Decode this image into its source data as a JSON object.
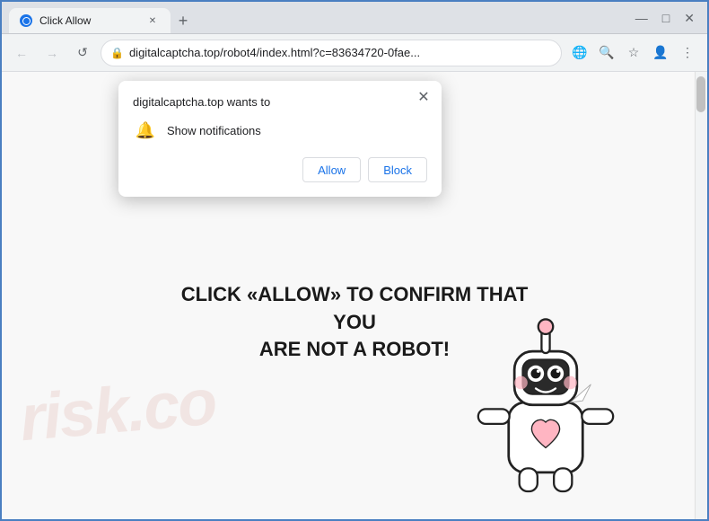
{
  "browser": {
    "title": "Click Allow",
    "tab_title": "Click Allow",
    "new_tab_label": "+",
    "url": "digitalcaptcha.top/robot4/index.html?c=83634720-0fae...",
    "window_controls": {
      "minimize": "—",
      "maximize": "□",
      "close": "✕"
    }
  },
  "nav": {
    "back_arrow": "←",
    "forward_arrow": "→",
    "refresh": "↺",
    "translate_icon": "🌐",
    "search_icon": "🔍",
    "bookmark_icon": "☆",
    "profile_icon": "👤",
    "menu_icon": "⋮",
    "dropdown_icon": "▾"
  },
  "popup": {
    "title": "digitalcaptcha.top wants to",
    "notification_label": "Show notifications",
    "close_icon": "✕",
    "allow_button": "Allow",
    "block_button": "Block"
  },
  "page": {
    "captcha_line1": "CLICK «ALLOW» TO CONFIRM THAT YOU",
    "captcha_line2": "ARE NOT A ROBOT!",
    "watermark": "risk.co"
  }
}
